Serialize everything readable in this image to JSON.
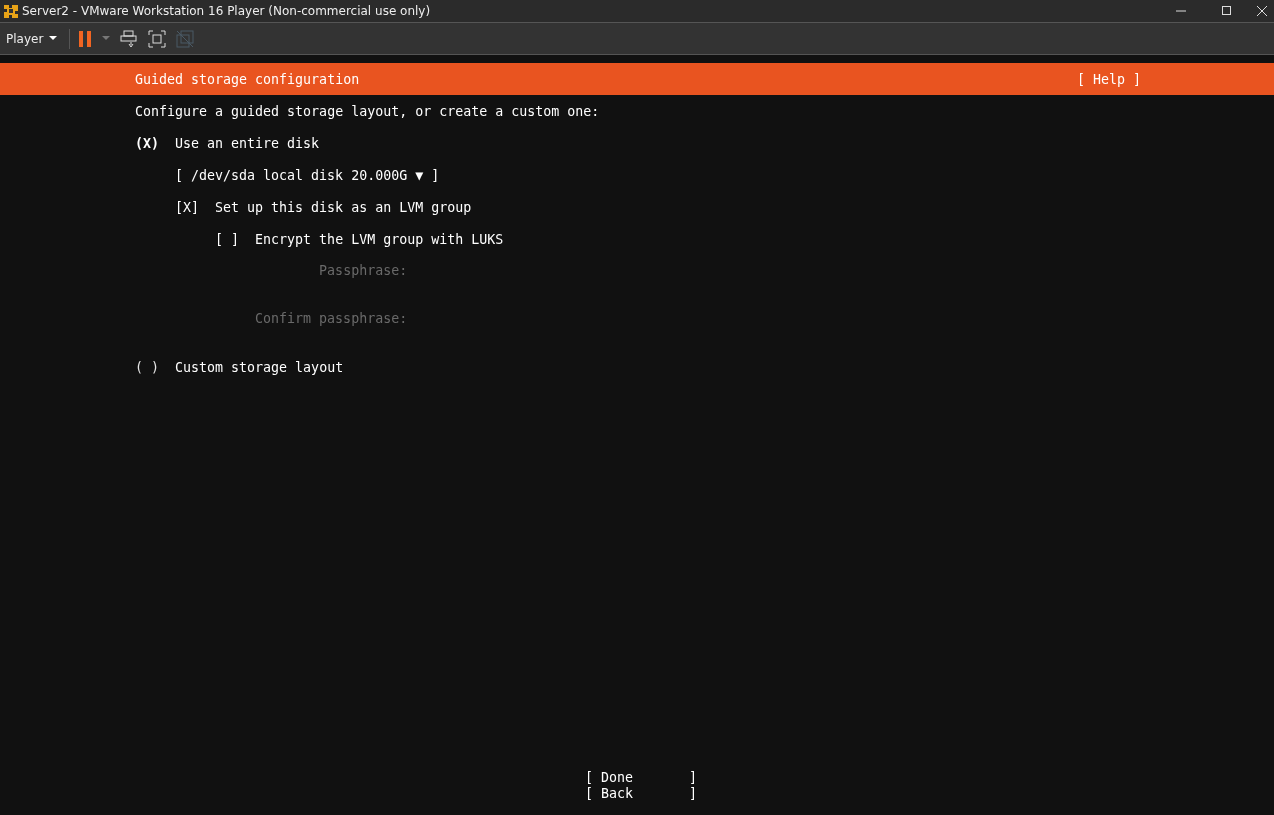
{
  "window": {
    "title": "Server2 - VMware Workstation 16 Player (Non-commercial use only)"
  },
  "toolbar": {
    "menu": "Player"
  },
  "header": {
    "title": "Guided storage configuration",
    "help": "[ Help ]"
  },
  "marks": {
    "radio_on": "(X)",
    "radio_off": "( )",
    "check_on": "[X]",
    "check_off": "[ ]"
  },
  "intro": "Configure a guided storage layout, or create a custom one:",
  "options": [
    {
      "label": "Use an entire disk",
      "selected": true
    },
    {
      "label": "Custom storage layout",
      "selected": false
    }
  ],
  "disk": {
    "label": "[ /dev/sda local disk 20.000G ▼ ]"
  },
  "lvm": {
    "label": "Set up this disk as an LVM group",
    "checked": true
  },
  "encrypt": {
    "label": "Encrypt the LVM group with LUKS",
    "checked": false
  },
  "passphrase_fields": [
    {
      "label": "Passphrase:",
      "disabled": true
    },
    {
      "label": "Confirm passphrase:",
      "disabled": true
    }
  ],
  "buttons": [
    "[ Done       ]",
    "[ Back       ]"
  ]
}
